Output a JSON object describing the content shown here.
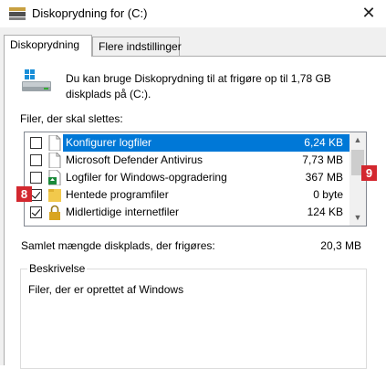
{
  "window": {
    "title": "Diskoprydning for  (C:)",
    "close_symbol": "✕"
  },
  "tabs": [
    {
      "label": "Diskoprydning",
      "active": true
    },
    {
      "label": "Flere indstillinger",
      "active": false
    }
  ],
  "info": {
    "text": "Du kan bruge Diskoprydning til at frigøre op til 1,78 GB diskplads på  (C:)."
  },
  "files_label": "Filer, der skal slettes:",
  "files": [
    {
      "name": "Konfigurer logfiler",
      "size": "6,24 KB",
      "checked": false,
      "selected": true,
      "icon": "blank-file-icon"
    },
    {
      "name": "Microsoft Defender Antivirus",
      "size": "7,73 MB",
      "checked": false,
      "selected": false,
      "icon": "blank-file-icon"
    },
    {
      "name": "Logfiler for Windows-opgradering",
      "size": "367 MB",
      "checked": false,
      "selected": false,
      "icon": "upgrade-log-icon"
    },
    {
      "name": "Hentede programfiler",
      "size": "0 byte",
      "checked": true,
      "selected": false,
      "icon": "folder-icon"
    },
    {
      "name": "Midlertidige internetfiler",
      "size": "124 KB",
      "checked": true,
      "selected": false,
      "icon": "lock-icon"
    }
  ],
  "badges": {
    "left": "8",
    "right": "9"
  },
  "total": {
    "label": "Samlet mængde diskplads, der frigøres:",
    "value": "20,3 MB"
  },
  "description": {
    "title": "Beskrivelse",
    "text": "Filer, der er oprettet af Windows"
  },
  "colors": {
    "selection": "#0078d7",
    "badge": "#d3282f"
  }
}
